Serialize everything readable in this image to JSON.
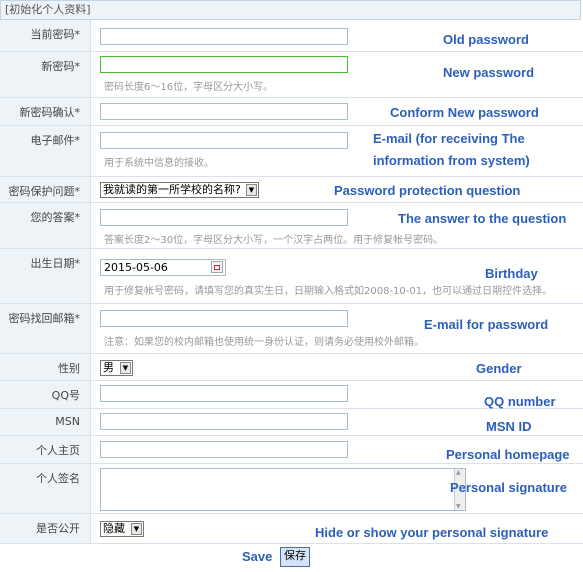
{
  "header": {
    "title": "[初始化个人资料]"
  },
  "rows": {
    "old_password": {
      "label": "当前密码*",
      "annotation": "Old password"
    },
    "new_password": {
      "label": "新密码*",
      "hint": "密码长度6～16位，字母区分大小写。",
      "annotation": "New password"
    },
    "confirm_password": {
      "label": "新密码确认*",
      "annotation": "Conform New password"
    },
    "email": {
      "label": "电子邮件*",
      "hint": "用于系统中信息的接收。",
      "annotation_line1": "E-mail (for receiving The",
      "annotation_line2": "information  from system)"
    },
    "security_question": {
      "label": "密码保护问题*",
      "value": "我就读的第一所学校的名称?",
      "annotation": "Password protection question"
    },
    "answer": {
      "label": "您的答案*",
      "hint": "答案长度2～30位，字母区分大小写，一个汉字占两位。用于修复帐号密码。",
      "annotation": "The answer to the question"
    },
    "birthday": {
      "label": "出生日期*",
      "value": "2015-05-06",
      "hint_line1": "用于修复帐号密码，请填写您的真实生日，日期输入格式如2008-10-01，也可以通过日期控件选择。",
      "annotation": "Birthday"
    },
    "recovery_email": {
      "label": "密码找回邮箱*",
      "hint": "注意：如果您的校内邮箱也使用统一身份认证，则请务必使用校外邮箱。",
      "annotation": "E-mail for password"
    },
    "gender": {
      "label": "性别",
      "value": "男",
      "annotation": "Gender"
    },
    "qq": {
      "label": "QQ号",
      "annotation": "QQ number"
    },
    "msn": {
      "label": "MSN",
      "annotation": "MSN ID"
    },
    "homepage": {
      "label": "个人主页",
      "annotation": "Personal homepage"
    },
    "signature": {
      "label": "个人签名",
      "annotation": "Personal signature"
    },
    "public": {
      "label": "是否公开",
      "value": "隐藏",
      "annotation": "Hide or show your personal signature"
    }
  },
  "footer": {
    "save_annotation": "Save",
    "save_label": "保存"
  }
}
